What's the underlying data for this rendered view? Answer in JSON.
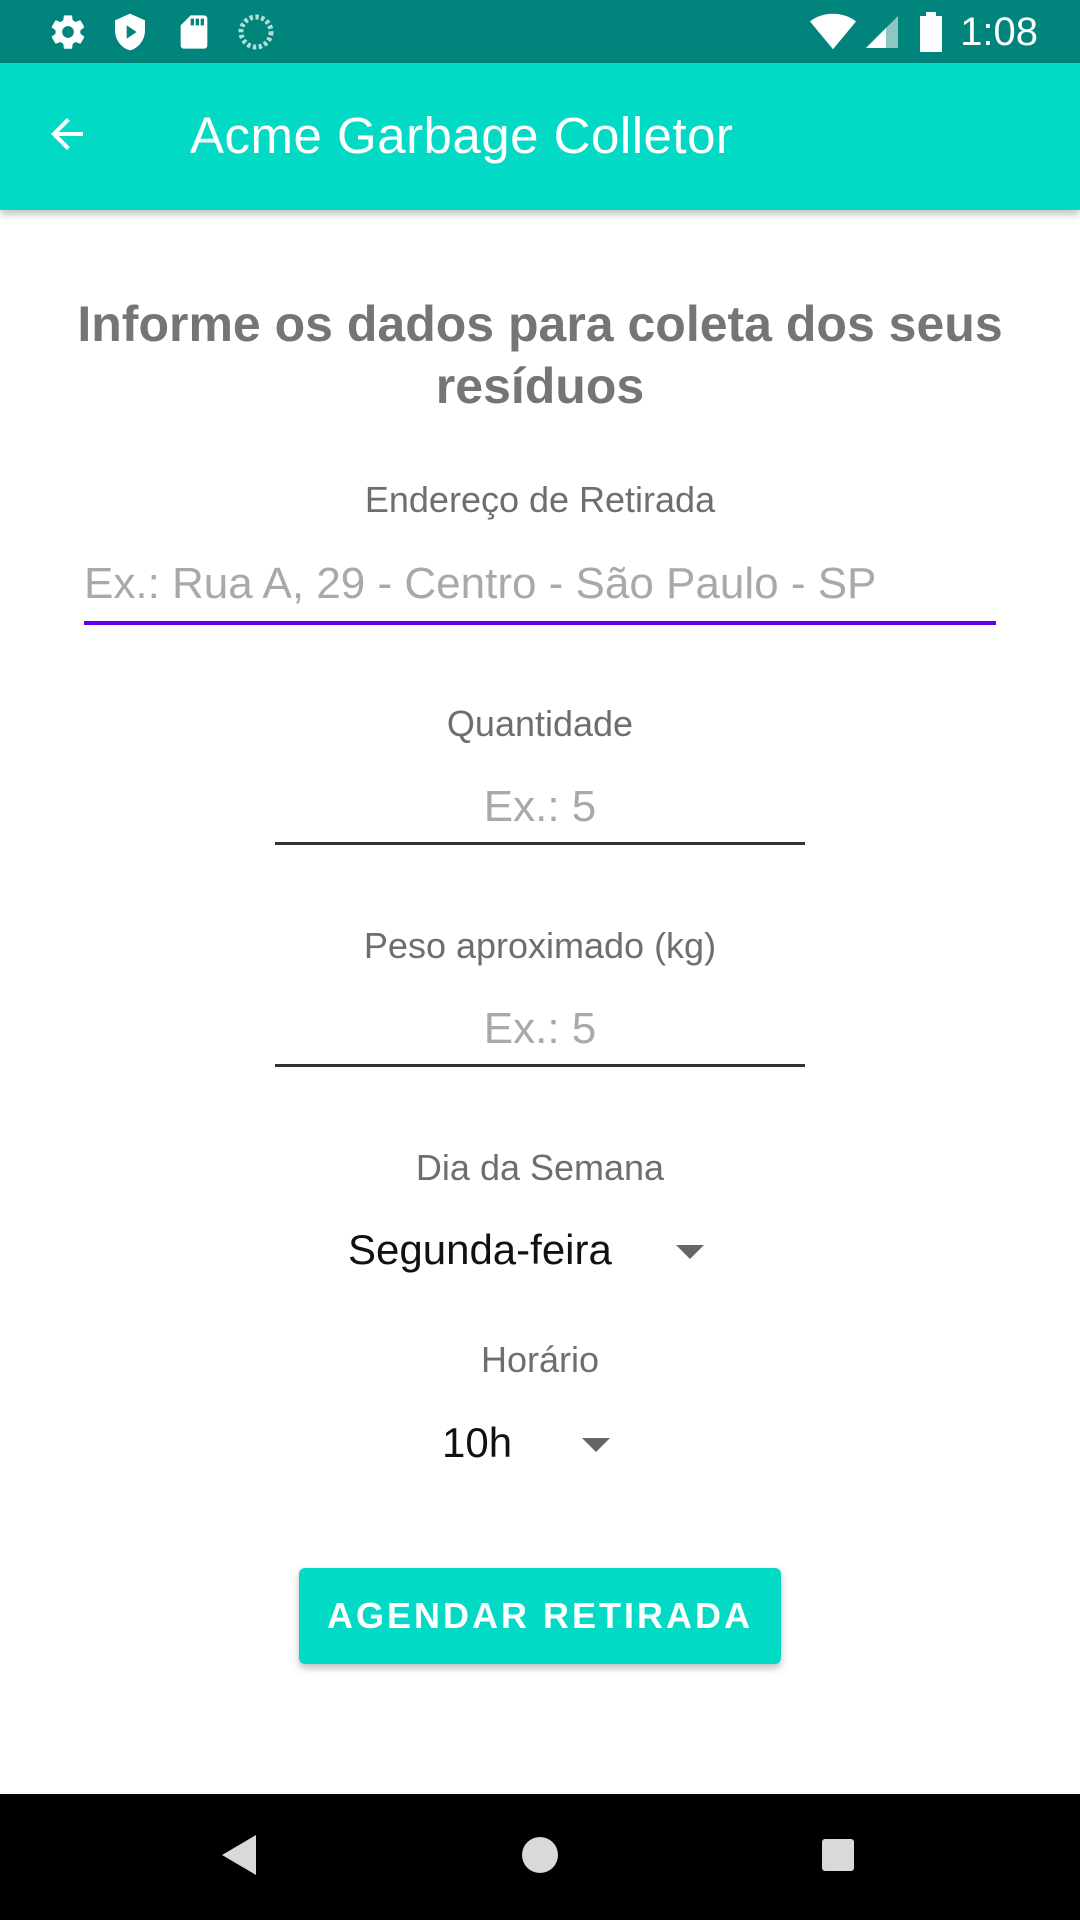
{
  "status_bar": {
    "time": "1:08",
    "left_icons": [
      "gear-icon",
      "shield-play-icon",
      "sd-card-icon",
      "sync-circle-icon"
    ],
    "right_icons": [
      "wifi-icon",
      "signal-icon",
      "battery-icon"
    ]
  },
  "app_bar": {
    "title": "Acme Garbage Colletor",
    "back_icon": "arrow-back-icon",
    "color": "#03dac5"
  },
  "form": {
    "heading": "Informe os dados para coleta dos seus resíduos",
    "address": {
      "label": "Endereço de Retirada",
      "placeholder": "Ex.: Rua A, 29 - Centro - São Paulo - SP",
      "value": ""
    },
    "quantity": {
      "label": "Quantidade",
      "placeholder": "Ex.: 5",
      "value": ""
    },
    "weight": {
      "label": "Peso aproximado (kg)",
      "placeholder": "Ex.: 5",
      "value": ""
    },
    "weekday": {
      "label": "Dia da Semana",
      "selected": "Segunda-feira"
    },
    "time": {
      "label": "Horário",
      "selected": "10h"
    },
    "submit_label": "AGENDAR RETIRADA"
  },
  "colors": {
    "status_bar": "#00847b",
    "accent": "#03dac5",
    "focus_underline": "#6200ee"
  },
  "nav_bar": {
    "icons": [
      "back-triangle-icon",
      "home-circle-icon",
      "recents-square-icon"
    ]
  }
}
